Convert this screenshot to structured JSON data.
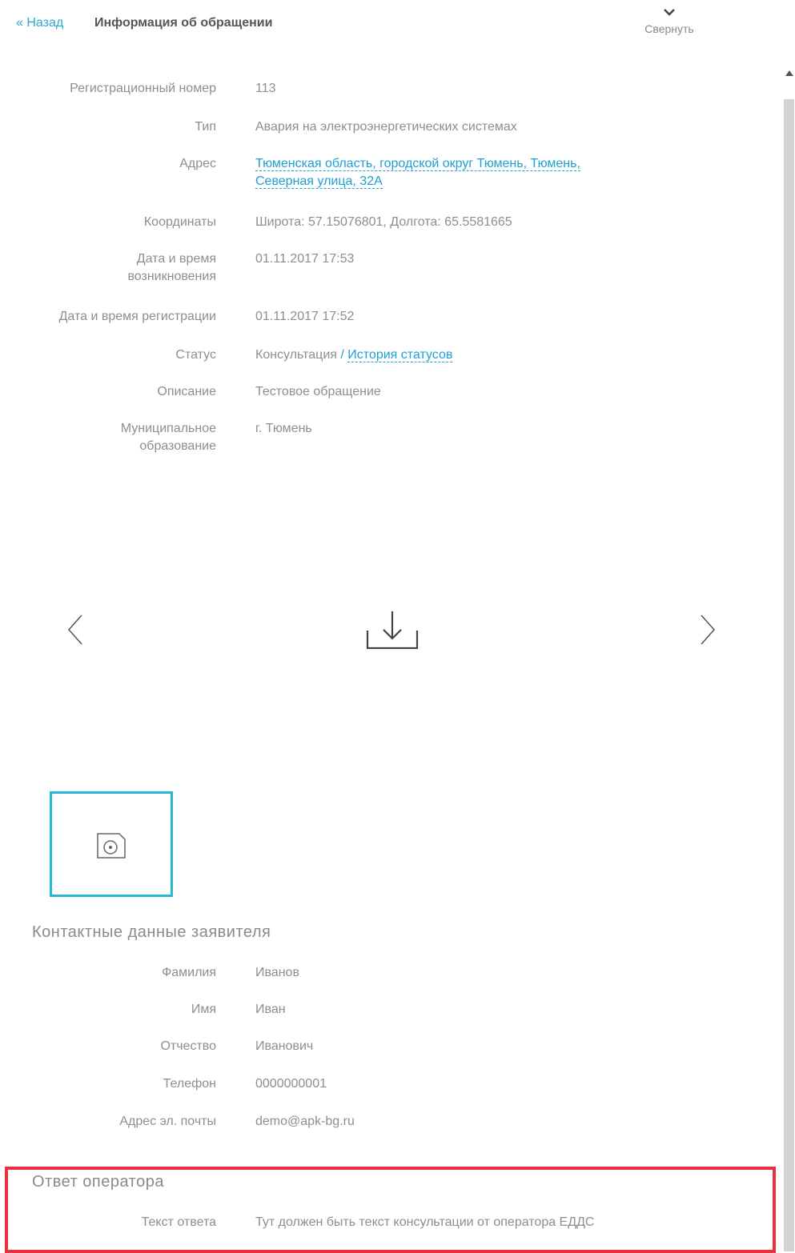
{
  "header": {
    "back_label": "« Назад",
    "title": "Информация об обращении",
    "collapse_label": "Свернуть"
  },
  "details": [
    {
      "label": "Регистрационный номер",
      "value": "113"
    },
    {
      "label": "Тип",
      "value": "Авария на электроэнергетических системах"
    },
    {
      "label": "Адрес",
      "value_line1": "Тюменская область, городской округ Тюмень, Тюмень,",
      "value_line2": "Северная улица, 32А"
    },
    {
      "label": "Координаты",
      "value": "Широта: 57.15076801, Долгота: 65.5581665"
    },
    {
      "label": "Дата и время\nвозникновения",
      "value": "01.11.2017 17:53"
    },
    {
      "label": "Дата и время регистрации",
      "value": "01.11.2017 17:52"
    },
    {
      "label": "Статус",
      "value": "Консультация",
      "separator": " / ",
      "link": "История статусов"
    },
    {
      "label": "Описание",
      "value": "Тестовое обращение"
    },
    {
      "label": "Муниципальное\nобразование",
      "value": "г. Тюмень"
    }
  ],
  "gallery": {
    "prev_icon": "chevron-left-icon",
    "next_icon": "chevron-right-icon",
    "download_icon": "download-icon",
    "thumbnail_icon": "photo-icon"
  },
  "contacts": {
    "title": "Контактные данные заявителя",
    "rows": [
      {
        "label": "Фамилия",
        "value": "Иванов"
      },
      {
        "label": "Имя",
        "value": "Иван"
      },
      {
        "label": "Отчество",
        "value": "Иванович"
      },
      {
        "label": "Телефон",
        "value": "0000000001"
      },
      {
        "label": "Адрес эл. почты",
        "value": "demo@apk-bg.ru"
      }
    ]
  },
  "answer": {
    "title": "Ответ оператора",
    "label": "Текст ответа",
    "value": "Тут должен быть текст консультации от оператора ЕДДС"
  },
  "colors": {
    "link": "#1f9fd2",
    "highlight": "#e8303a",
    "thumb_border": "#27b8d6"
  }
}
